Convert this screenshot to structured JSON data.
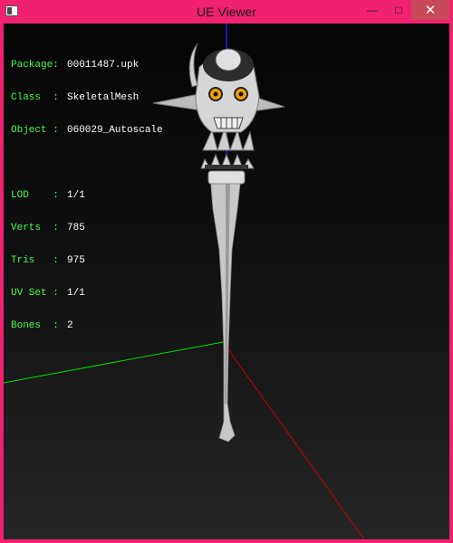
{
  "window": {
    "title": "UE Viewer",
    "close_glyph": "✕",
    "min_glyph": "—",
    "max_glyph": "□"
  },
  "info": {
    "package": {
      "label": "Package:",
      "value": "00011487.upk"
    },
    "class": {
      "label": "Class  :",
      "value": "SkeletalMesh"
    },
    "object": {
      "label": "Object :",
      "value": "060029_Autoscale"
    },
    "lod": {
      "label": "LOD    :",
      "value": "1/1"
    },
    "verts": {
      "label": "Verts  :",
      "value": "785"
    },
    "tris": {
      "label": "Tris   :",
      "value": "975"
    },
    "uvset": {
      "label": "UV Set :",
      "value": "1/1"
    },
    "bones": {
      "label": "Bones  :",
      "value": "2"
    }
  },
  "colors": {
    "titlebar": "#f0216f",
    "label": "#40ff40",
    "axis_x": "#ff0000",
    "axis_y": "#00ff00",
    "axis_z": "#2020ff"
  },
  "icons": {
    "app": "window-icon"
  }
}
